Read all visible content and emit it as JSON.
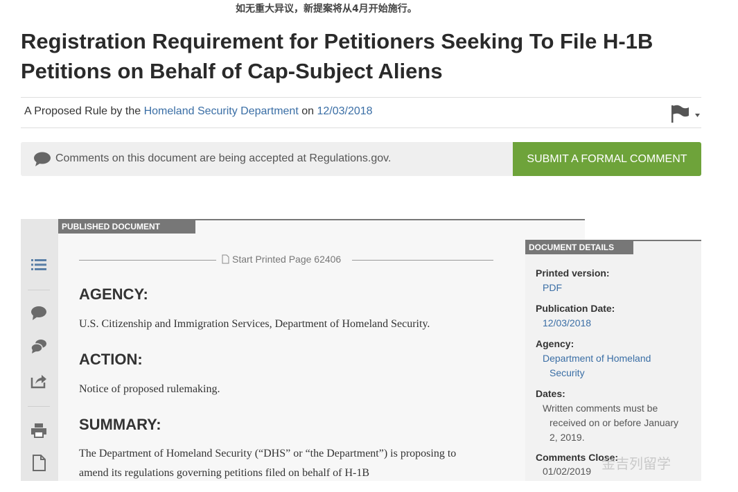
{
  "caption": "如无重大异议，新提案将从4月开始施行。",
  "document": {
    "title": "Registration Requirement for Petitioners Seeking To File H-1B Petitions on Behalf of Cap-Subject Aliens",
    "meta": {
      "prefix": "A Proposed Rule by the",
      "agency_link": "Homeland Security Department",
      "on": "on",
      "date_link": "12/03/2018"
    }
  },
  "comment_bar": {
    "text": "Comments on this document are being accepted at Regulations.gov.",
    "button": "SUBMIT A FORMAL COMMENT"
  },
  "rail": {
    "icons": [
      "table-of-contents-icon",
      "comment-icon",
      "discussion-icon",
      "share-icon",
      "print-icon",
      "document-icon"
    ]
  },
  "published": {
    "label": "PUBLISHED DOCUMENT",
    "page_marker": "Start Printed Page 62406",
    "sections": [
      {
        "heading": "AGENCY:",
        "text": "U.S. Citizenship and Immigration Services, Department of Homeland Security."
      },
      {
        "heading": "ACTION:",
        "text": "Notice of proposed rulemaking."
      },
      {
        "heading": "SUMMARY:",
        "text": "The Department of Homeland Security (“DHS” or “the Department”) is proposing to amend its regulations governing petitions filed on behalf of H-1B"
      }
    ]
  },
  "details": {
    "label": "DOCUMENT DETAILS",
    "printed_version_key": "Printed version:",
    "printed_version_value": "PDF",
    "publication_date_key": "Publication Date:",
    "publication_date_value": "12/03/2018",
    "agency_key": "Agency:",
    "agency_value_1": "Department of Homeland",
    "agency_value_2": "Security",
    "dates_key": "Dates:",
    "dates_value_1": "Written comments must be",
    "dates_value_2": "received on or before January",
    "dates_value_3": "2, 2019.",
    "comments_close_key": "Comments Close:",
    "comments_close_value": "01/02/2019"
  },
  "watermark": "金吉列留学",
  "colors": {
    "link": "#3a6ea5",
    "button_green": "#6ea33a",
    "label_gray": "#777777"
  }
}
